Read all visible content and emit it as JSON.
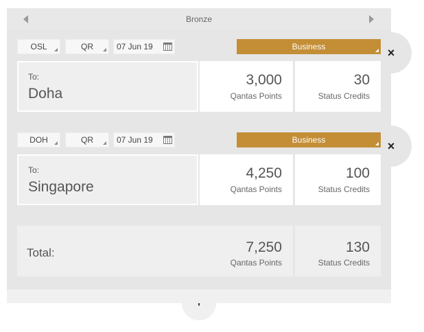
{
  "tier": {
    "label": "Bronze",
    "prev_icon": "triangle-left-icon",
    "next_icon": "triangle-right-icon"
  },
  "segments": [
    {
      "origin": "OSL",
      "airline": "QR",
      "date": "07 Jun 19",
      "cabin": "Business",
      "to_label": "To:",
      "destination": "Doha",
      "points": "3,000",
      "points_label": "Qantas Points",
      "credits": "30",
      "credits_label": "Status Credits",
      "remove_label": "×"
    },
    {
      "origin": "DOH",
      "airline": "QR",
      "date": "07 Jun 19",
      "cabin": "Business",
      "to_label": "To:",
      "destination": "Singapore",
      "points": "4,250",
      "points_label": "Qantas Points",
      "credits": "100",
      "credits_label": "Status Credits",
      "remove_label": "×"
    }
  ],
  "total": {
    "label": "Total:",
    "points": "7,250",
    "points_label": "Qantas Points",
    "credits": "130",
    "credits_label": "Status Credits"
  },
  "add_label": "+",
  "colors": {
    "cabin_accent": "#c38e35",
    "panel_bg": "#e6e6e6"
  }
}
